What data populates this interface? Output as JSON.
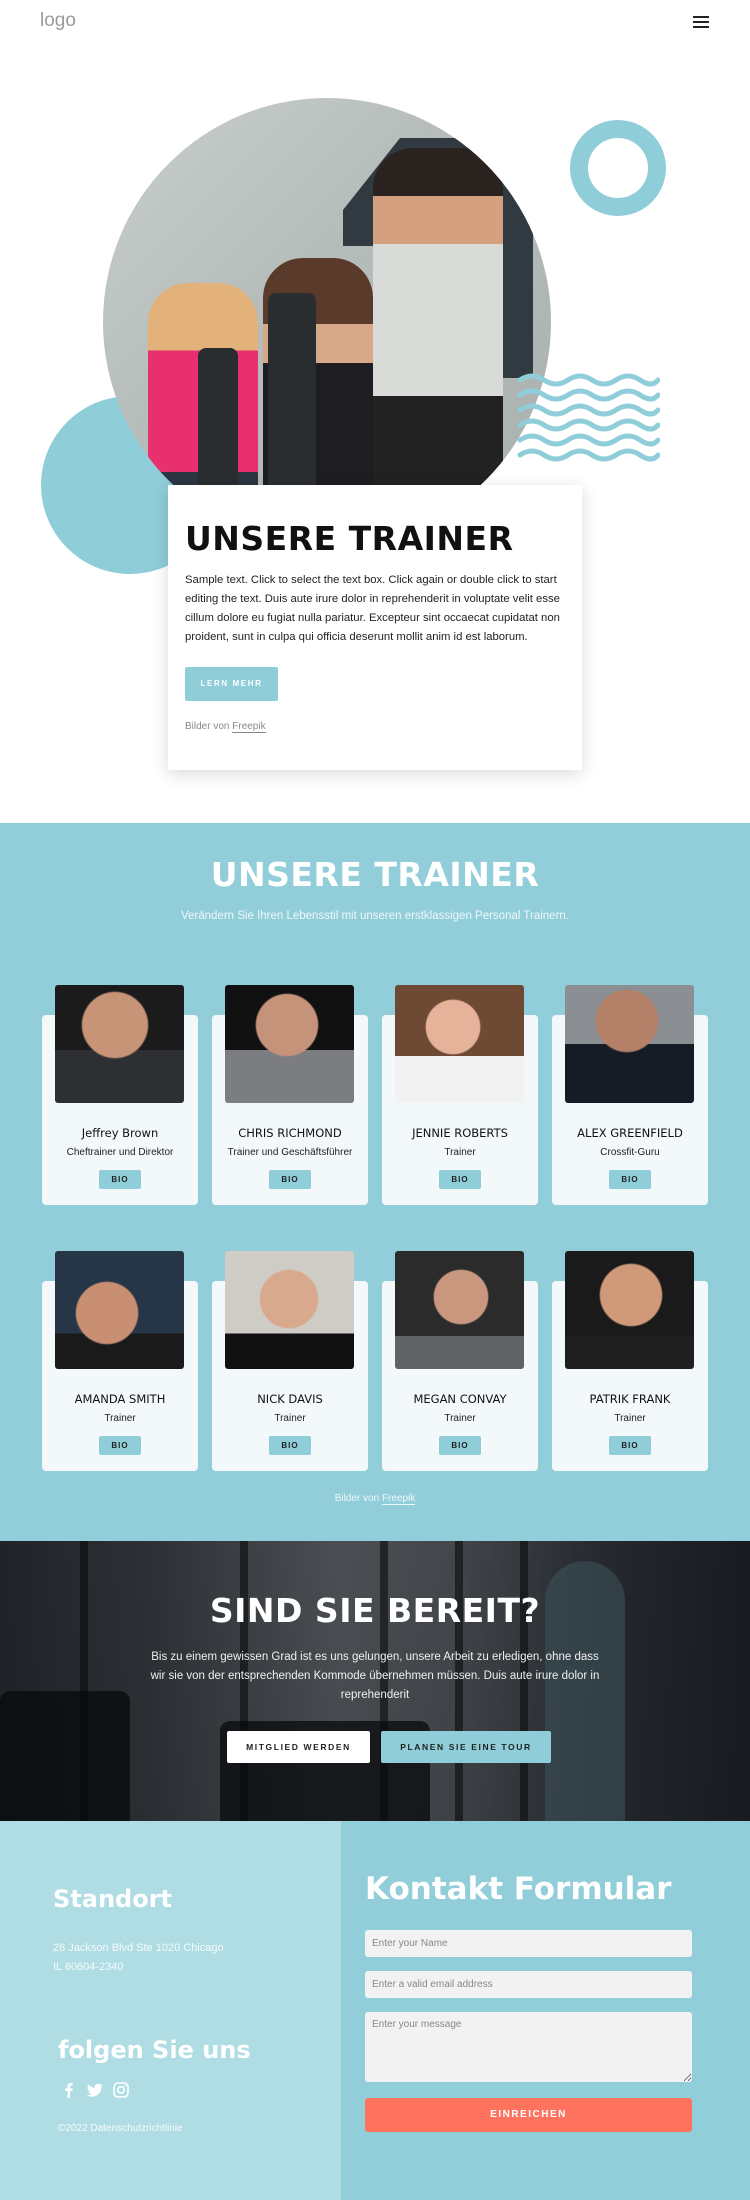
{
  "header": {
    "logo": "logo",
    "menu_icon": "hamburger-menu-icon"
  },
  "hero": {
    "title": "UNSERE TRAINER",
    "text": "Sample text. Click to select the text box. Click again or double click to start editing the text. Duis aute irure dolor in reprehenderit in voluptate velit esse cillum dolore eu fugiat nulla pariatur. Excepteur sint occaecat cupidatat non proident, sunt in culpa qui officia deserunt mollit anim id est laborum.",
    "button": "LERN MEHR",
    "credit_prefix": "Bilder von ",
    "credit_link": "Freepik"
  },
  "trainers": {
    "title": "UNSERE TRAINER",
    "subtitle": "Verändern Sie Ihren Lebensstil mit unseren erstklassigen Personal Trainern.",
    "bio_label": "BIO",
    "items": [
      {
        "name": "Jeffrey Brown",
        "role": "Cheftrainer und Direktor"
      },
      {
        "name": "CHRIS RICHMOND",
        "role": "Trainer und Geschäftsführer"
      },
      {
        "name": "JENNIE ROBERTS",
        "role": "Trainer"
      },
      {
        "name": "ALEX GREENFIELD",
        "role": "Crossfit-Guru"
      },
      {
        "name": "AMANDA SMITH",
        "role": "Trainer"
      },
      {
        "name": "NICK DAVIS",
        "role": "Trainer"
      },
      {
        "name": "MEGAN CONVAY",
        "role": "Trainer"
      },
      {
        "name": "PATRIK FRANK",
        "role": "Trainer"
      }
    ],
    "credit_prefix": "Bilder von ",
    "credit_link": "Freepik"
  },
  "cta": {
    "title": "SIND SIE BEREIT?",
    "text": "Bis zu einem gewissen Grad ist es uns gelungen, unsere Arbeit zu erledigen, ohne dass wir sie von der entsprechenden Kommode übernehmen müssen. Duis aute irure dolor in reprehenderit",
    "button_member": "MITGLIED WERDEN",
    "button_tour": "PLANEN SIE EINE TOUR"
  },
  "footer": {
    "location_title": "Standort",
    "address_line1": "28 Jackson Blvd Ste 1020 Chicago",
    "address_line2": "IL 60604-2340",
    "follow_title": "folgen Sie uns",
    "socials": [
      "facebook-icon",
      "twitter-icon",
      "instagram-icon"
    ],
    "copyright": "©2022 Datenschutzrichtlinie"
  },
  "contact": {
    "title": "Kontakt Formular",
    "name_placeholder": "Enter your Name",
    "email_placeholder": "Enter a valid email address",
    "message_placeholder": "Enter your message",
    "submit": "EINREICHEN"
  },
  "colors": {
    "accent": "#8fcdd9",
    "section_bg": "#92ced9",
    "footer_left_bg": "#b0dde4",
    "submit": "#ff725e"
  }
}
